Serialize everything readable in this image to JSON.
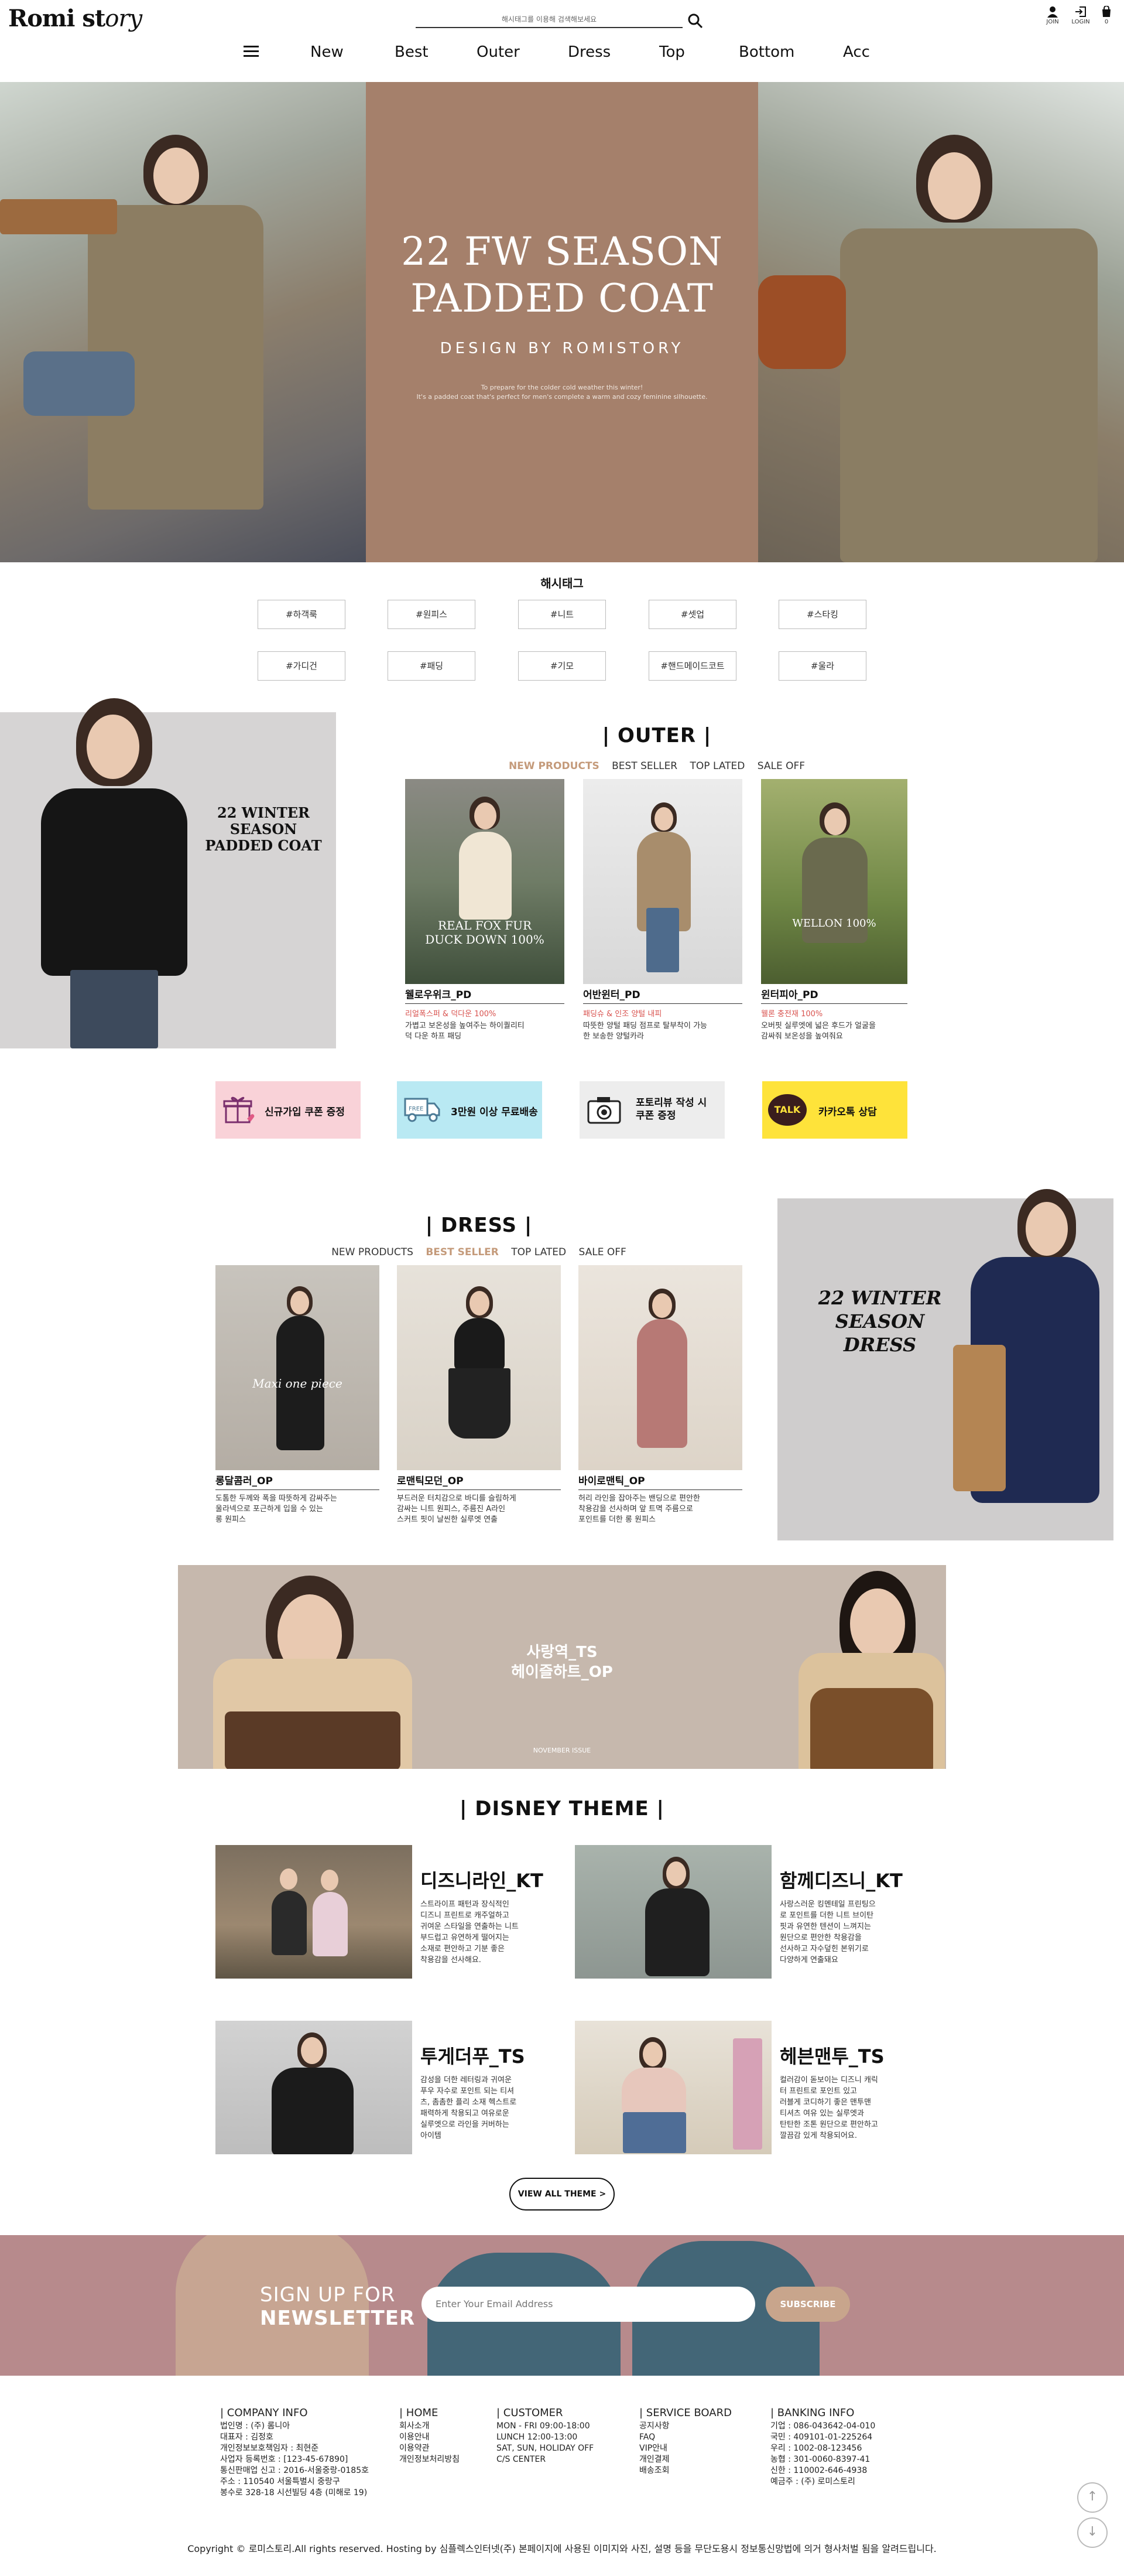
{
  "header": {
    "logo_main": "Romi st",
    "logo_tail": "ory",
    "search_placeholder": "해시태그를 이용해 검색해보세요",
    "utils": [
      {
        "label": "JOIN"
      },
      {
        "label": "LOGIN"
      },
      {
        "label": "0"
      }
    ],
    "nav": [
      "New",
      "Best",
      "Outer",
      "Dress",
      "Top",
      "Bottom",
      "Acc"
    ]
  },
  "hero": {
    "title_line1": "22 FW SEASON",
    "title_line2": "PADDED COAT",
    "subtitle": "DESIGN BY ROMISTORY",
    "small_line1": "To prepare for the colder cold weather this winter!",
    "small_line2": "It's a padded coat that's perfect for men's complete a warm and cozy feminine silhouette."
  },
  "hashtags": {
    "title": "해시태그",
    "row1": [
      "#하객룩",
      "#원피스",
      "#니트",
      "#셋업",
      "#스타킹"
    ],
    "row2": [
      "#가디건",
      "#패딩",
      "#기모",
      "#핸드메이드코트",
      "#울라"
    ]
  },
  "outer": {
    "promo_line1": "22 WINTER SEASON",
    "promo_line2": "PADDED COAT",
    "title": "| OUTER |",
    "tabs": [
      "NEW PRODUCTS",
      "BEST SELLER",
      "TOP LATED",
      "SALE OFF"
    ],
    "products": [
      {
        "overlay1": "REAL FOX FUR",
        "overlay2": "DUCK DOWN 100%",
        "name": "웰로우위크_PD",
        "tag": "리얼폭스퍼 & 덕다운 100%",
        "desc1": "가볍고 보온성을 높여주는 하이퀄리티",
        "desc2": "덕 다운 하프 패딩"
      },
      {
        "overlay1": "",
        "overlay2": "",
        "name": "어반윈터_PD",
        "tag": "패딩슈 & 인조 양털 내피",
        "desc1": "따뜻한 양털 패딩 점프로 탈부착이 가능",
        "desc2": "한 보송한 양털카라"
      },
      {
        "overlay1": "WELLON 100%",
        "overlay2": "",
        "name": "윈터피아_PD",
        "tag": "웰론 충전재 100%",
        "desc1": "오버핏 실루엣에 넓은 후드가 얼굴을",
        "desc2": "감싸줘 보온성을 높여줘요"
      }
    ]
  },
  "banners": [
    {
      "label": "신규가입 쿠폰 증정",
      "bg": "#f9d2d8"
    },
    {
      "label": "3만원 이상 무료배송",
      "bg": "#b9e9f3"
    },
    {
      "label1": "포토리뷰 작성 시",
      "label2": "쿠폰 증정",
      "bg": "#ededed"
    },
    {
      "label": "카카오톡 상담",
      "bg": "#fee33a",
      "icon_text": "TALK"
    }
  ],
  "dress": {
    "title": "| DRESS |",
    "tabs": [
      "NEW PRODUCTS",
      "BEST SELLER",
      "TOP LATED",
      "SALE OFF"
    ],
    "promo_line1": "22 WINTER SEASON",
    "promo_line2": "DRESS",
    "products": [
      {
        "overlay": "Maxi one piece",
        "name": "롱달콤러_OP",
        "desc1": "도톰한 두께와 폭을 따뜻하게 감싸주는",
        "desc2": "울라넥으로 포근하게 입을 수 있는",
        "desc3": "롱 원피스"
      },
      {
        "overlay": "",
        "name": "로맨틱모던_OP",
        "desc1": "부드러운 터치감으로 바디를 슬림하게",
        "desc2": "감싸는 니트 원피스, 주름진 A라인",
        "desc3": "스커트 핏이 날씬한 실루엣 연출"
      },
      {
        "overlay": "",
        "name": "바이로맨틱_OP",
        "desc1": "허리 라인을 잡아주는 밴딩으로 편안한",
        "desc2": "착용감을 선사하며 앞 트멱 주름으로",
        "desc3": "포인트를 더한 롱 원피스"
      }
    ]
  },
  "wide_banner": {
    "line1": "사랑역_TS",
    "line2": "헤이즐하트_OP",
    "small": "NOVEMBER ISSUE"
  },
  "disney": {
    "title": "| DISNEY THEME |",
    "items": [
      {
        "name": "디즈니라인_KT",
        "desc": [
          "스트라이프 패턴과 장식적인",
          "디즈니 프린트로 캐주얼하고",
          "귀여운 스타일을 연출하는 니트",
          "부드럽고 유연하게 떨어지는",
          "소재로 편안하고 기분 좋은",
          "착용감을 선사해요."
        ]
      },
      {
        "name": "함께디즈니_KT",
        "desc": [
          "사랑스러운 킹멘테일 프린팅으",
          "로 포인트를 더한 니트 브이탄",
          "핏과 유연한 텐션이 느껴지는",
          "원단으로 편안한 착용감을",
          "선사하고 자수덮힌 본위기로",
          "다양하게 연출돼요"
        ]
      },
      {
        "name": "투게더푸_TS",
        "desc": [
          "감성을 더한 레터링과 귀여운",
          "푸우 자수로 포인트 되는 티셔",
          "츠, 촘촘한 플리 소재 헥스트로",
          "패력하게 착용되고 여유로운",
          "실루엣으로 라인을 커버하는",
          "아이템"
        ]
      },
      {
        "name": "헤븐맨투_TS",
        "desc": [
          "컬러감이 돋보이는 디즈니 캐릭",
          "터 프린트로 포인트 있고",
          "러블게 코디하기 좋은 맨투맨",
          "티셔츠 여유 있는 실루엣과",
          "탄탄한 조톤 원단으로 편안하고",
          "깔끔감 있게 착용되어요."
        ]
      }
    ],
    "view_all": "VIEW ALL THEME >"
  },
  "newsletter": {
    "line1": "SIGN UP FOR",
    "line2": "NEWSLETTER",
    "placeholder": "Enter Your Email Address",
    "button": "SUBSCRIBE"
  },
  "footer": {
    "cols": [
      {
        "head": "| COMPANY INFO",
        "lines": [
          "법인명 : (주) 롬니아",
          "대표자 : 김정호",
          "개인정보보호책임자 : 최현준",
          "사업자 등록번호 : [123-45-67890]",
          "통신판매업 신고 : 2016-서울중랑-0185호",
          "주소 : 110540 서울특별시 중랑구",
          "봉수로 328-18 시선빌딩 4층 (미해로 19)"
        ]
      },
      {
        "head": "| HOME",
        "lines": [
          "회사소개",
          "이용안내",
          "이용약관",
          "개인정보처리방침"
        ]
      },
      {
        "head": "| CUSTOMER",
        "lines": [
          "MON - FRI 09:00-18:00",
          "LUNCH 12:00-13:00",
          "SAT, SUN, HOLIDAY OFF",
          "C/S CENTER"
        ]
      },
      {
        "head": "| SERVICE BOARD",
        "lines": [
          "공지사항",
          "FAQ",
          "VIP안내",
          "개인결제",
          "배송조회"
        ]
      },
      {
        "head": "| BANKING INFO",
        "lines": [
          "기업 : 086-043642-04-010",
          "국민 : 409101-01-225264",
          "우리 : 1002-08-123456",
          "농협 : 301-0060-8397-41",
          "신한 : 110002-646-4938",
          "예금주 : (주) 로미스토리"
        ]
      }
    ],
    "copyright": "Copyright © 로미스토리.All rights reserved. Hosting by 심플렉스인터넷(주) 본페이지에 사용된 이미지와 사진, 설명 등을 무단도용시 정보통신망법에 의거 형사처벌 됨을 알려드립니다."
  },
  "side_buttons": {
    "up": "↑",
    "down": "↓"
  }
}
